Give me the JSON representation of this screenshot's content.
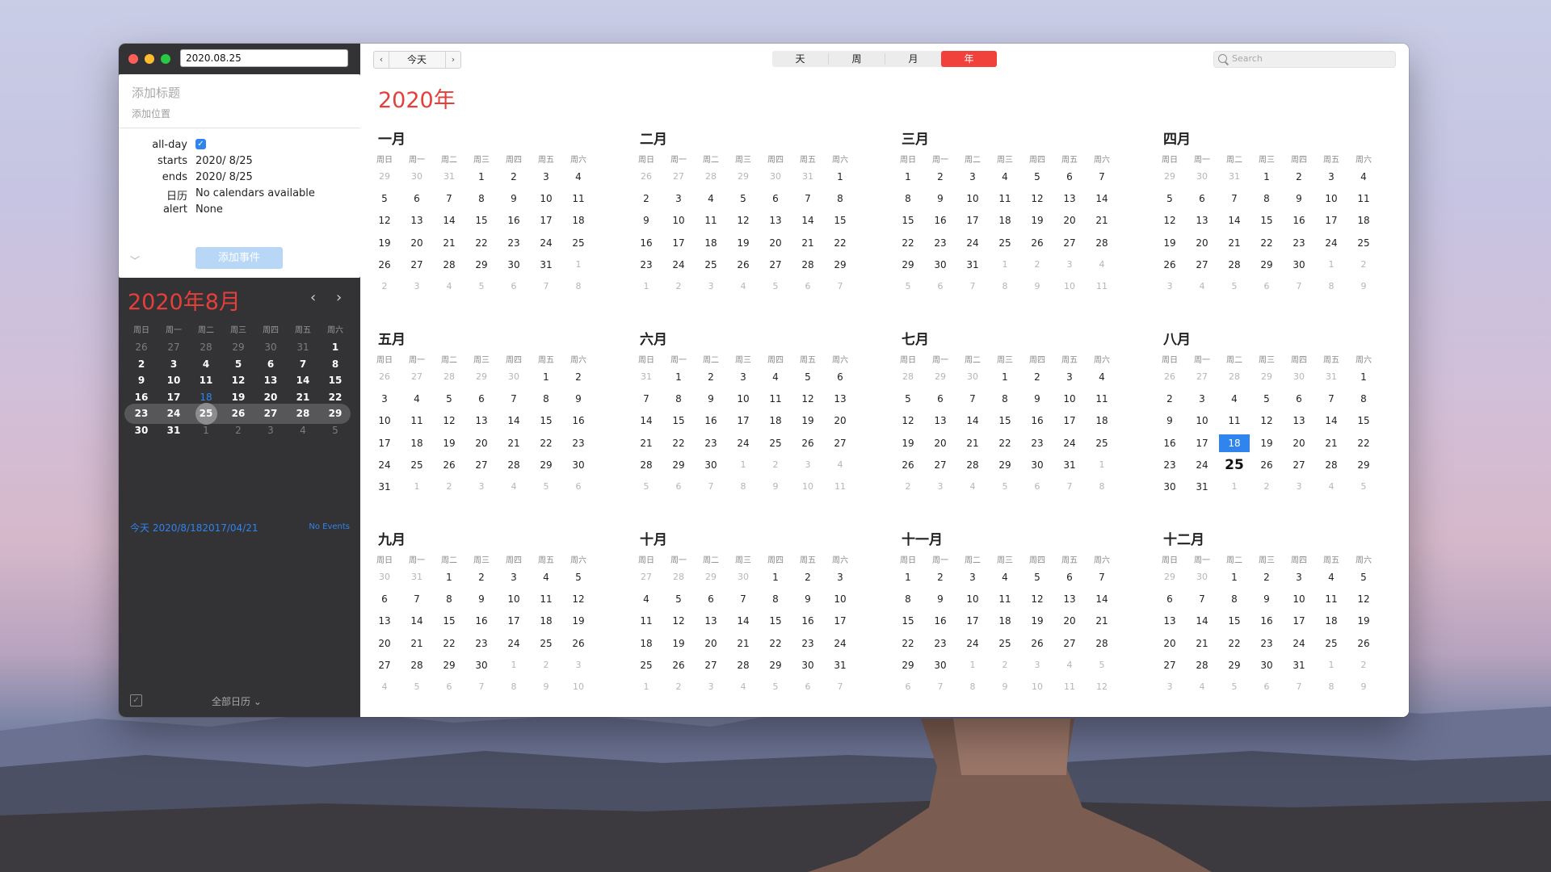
{
  "window": {
    "date_field_value": "2020.08.25"
  },
  "event_form": {
    "title_placeholder": "添加标题",
    "location_placeholder": "添加位置",
    "fields": [
      {
        "label": "all-day",
        "value": ""
      },
      {
        "label": "starts",
        "value": "2020/  8/25"
      },
      {
        "label": "ends",
        "value": "2020/  8/25"
      },
      {
        "label": "日历",
        "value": "No calendars available"
      },
      {
        "label": "alert",
        "value": "None"
      }
    ],
    "all_day_checked": true,
    "add_event_label": "添加事件",
    "collapse_glyph": "﹀"
  },
  "mini_calendar": {
    "title": "2020年8月",
    "prev_glyph": "‹",
    "next_glyph": "›",
    "weekdays": [
      "周日",
      "周一",
      "周二",
      "周三",
      "周四",
      "周五",
      "周六"
    ],
    "weeks": [
      [
        {
          "d": "26",
          "t": "dim"
        },
        {
          "d": "27",
          "t": "dim"
        },
        {
          "d": "28",
          "t": "dim"
        },
        {
          "d": "29",
          "t": "dim"
        },
        {
          "d": "30",
          "t": "dim"
        },
        {
          "d": "31",
          "t": "dim"
        },
        {
          "d": "1"
        }
      ],
      [
        {
          "d": "2"
        },
        {
          "d": "3"
        },
        {
          "d": "4"
        },
        {
          "d": "5"
        },
        {
          "d": "6"
        },
        {
          "d": "7"
        },
        {
          "d": "8"
        }
      ],
      [
        {
          "d": "9"
        },
        {
          "d": "10"
        },
        {
          "d": "11"
        },
        {
          "d": "12"
        },
        {
          "d": "13"
        },
        {
          "d": "14"
        },
        {
          "d": "15"
        }
      ],
      [
        {
          "d": "16"
        },
        {
          "d": "17"
        },
        {
          "d": "18",
          "t": "today"
        },
        {
          "d": "19"
        },
        {
          "d": "20"
        },
        {
          "d": "21"
        },
        {
          "d": "22"
        }
      ],
      [
        {
          "d": "23"
        },
        {
          "d": "24"
        },
        {
          "d": "25",
          "t": "sel"
        },
        {
          "d": "26"
        },
        {
          "d": "27"
        },
        {
          "d": "28"
        },
        {
          "d": "29"
        }
      ],
      [
        {
          "d": "30"
        },
        {
          "d": "31"
        },
        {
          "d": "1",
          "t": "dim"
        },
        {
          "d": "2",
          "t": "dim"
        },
        {
          "d": "3",
          "t": "dim"
        },
        {
          "d": "4",
          "t": "dim"
        },
        {
          "d": "5",
          "t": "dim"
        }
      ]
    ],
    "selected_week_index": 4,
    "today_line": "今天 2020/8/182017/04/21",
    "no_events": "No Events"
  },
  "sidebar_footer": {
    "todo_glyph": "✓",
    "calendars_filter": "全部日历 ⌄"
  },
  "toolbar": {
    "prev_glyph": "‹",
    "today_label": "今天",
    "next_glyph": "›",
    "views": [
      "天",
      "周",
      "月",
      "年"
    ],
    "active_view": "年",
    "search_placeholder": "Search"
  },
  "year_view": {
    "title": "2020年",
    "weekdays": [
      "周日",
      "周一",
      "周二",
      "周三",
      "周四",
      "周五",
      "周六"
    ],
    "months": [
      {
        "name": "一月",
        "lead": [
          "29",
          "30",
          "31"
        ],
        "days": 31,
        "sel": null,
        "today": null
      },
      {
        "name": "二月",
        "lead": [
          "26",
          "27",
          "28",
          "29",
          "30",
          "31"
        ],
        "days": 29,
        "sel": null,
        "today": null
      },
      {
        "name": "三月",
        "lead": [],
        "days": 31,
        "sel": null,
        "today": null
      },
      {
        "name": "四月",
        "lead": [
          "29",
          "30",
          "31"
        ],
        "days": 30,
        "sel": null,
        "today": null
      },
      {
        "name": "五月",
        "lead": [
          "26",
          "27",
          "28",
          "29",
          "30"
        ],
        "days": 31,
        "sel": null,
        "today": null
      },
      {
        "name": "六月",
        "lead": [
          "31"
        ],
        "days": 30,
        "sel": null,
        "today": null
      },
      {
        "name": "七月",
        "lead": [
          "28",
          "29",
          "30"
        ],
        "days": 31,
        "sel": null,
        "today": null
      },
      {
        "name": "八月",
        "lead": [
          "26",
          "27",
          "28",
          "29",
          "30",
          "31"
        ],
        "days": 31,
        "sel": "25",
        "today": "18"
      },
      {
        "name": "九月",
        "lead": [
          "30",
          "31"
        ],
        "days": 30,
        "sel": null,
        "today": null
      },
      {
        "name": "十月",
        "lead": [
          "27",
          "28",
          "29",
          "30"
        ],
        "days": 31,
        "sel": null,
        "today": null
      },
      {
        "name": "十一月",
        "lead": [],
        "days": 30,
        "sel": null,
        "today": null
      },
      {
        "name": "十二月",
        "lead": [
          "29",
          "30"
        ],
        "days": 31,
        "sel": null,
        "today": null
      }
    ]
  },
  "colors": {
    "accent_red": "#f0413b",
    "today_blue": "#2f84ee",
    "sidebar_bg": "#333234"
  }
}
